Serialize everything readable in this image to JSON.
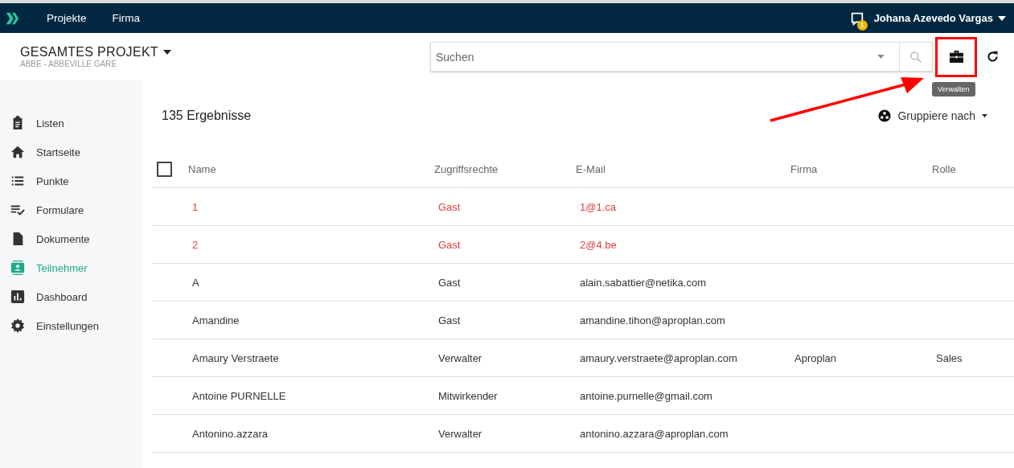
{
  "top_nav": {
    "links": [
      {
        "label": "Projekte"
      },
      {
        "label": "Firma"
      }
    ],
    "notification_count": "1",
    "user_name": "Johana Azevedo Vargas"
  },
  "project": {
    "title": "GESAMTES PROJEKT",
    "subtitle": "ABBE - ABBEVILLE GARE"
  },
  "search": {
    "placeholder": "Suchen"
  },
  "manage_tooltip": "Verwalten",
  "sidebar": {
    "items": [
      {
        "label": "Listen",
        "selected": false
      },
      {
        "label": "Startseite",
        "selected": false
      },
      {
        "label": "Punkte",
        "selected": false
      },
      {
        "label": "Formulare",
        "selected": false
      },
      {
        "label": "Dokumente",
        "selected": false
      },
      {
        "label": "Teilnehmer",
        "selected": true
      },
      {
        "label": "Dashboard",
        "selected": false
      },
      {
        "label": "Einstellungen",
        "selected": false
      }
    ]
  },
  "results_count": "135 Ergebnisse",
  "group_by": "Gruppiere nach",
  "table": {
    "select_all_checked": false,
    "columns": [
      "Name",
      "Zugriffsrechte",
      "E-Mail",
      "Firma",
      "Rolle"
    ],
    "rows": [
      {
        "cells": [
          "1",
          "Gast",
          "1@1.ca",
          "",
          ""
        ],
        "pending": true
      },
      {
        "cells": [
          "2",
          "Gast",
          "2@4.be",
          "",
          ""
        ],
        "pending": true
      },
      {
        "cells": [
          "A",
          "Gast",
          "alain.sabattier@netika.com",
          "",
          ""
        ],
        "pending": false
      },
      {
        "cells": [
          "Amandine",
          "Gast",
          "amandine.tihon@aproplan.com",
          "",
          ""
        ],
        "pending": false
      },
      {
        "cells": [
          "Amaury Verstraete",
          "Verwalter",
          "amaury.verstraete@aproplan.com",
          "Aproplan",
          "Sales"
        ],
        "pending": false
      },
      {
        "cells": [
          "Antoine PURNELLE",
          "Mitwirkender",
          "antoine.purnelle@gmail.com",
          "",
          ""
        ],
        "pending": false
      },
      {
        "cells": [
          "Antonino.azzara",
          "Verwalter",
          "antonino.azzara@aproplan.com",
          "",
          ""
        ],
        "pending": false
      }
    ]
  }
}
